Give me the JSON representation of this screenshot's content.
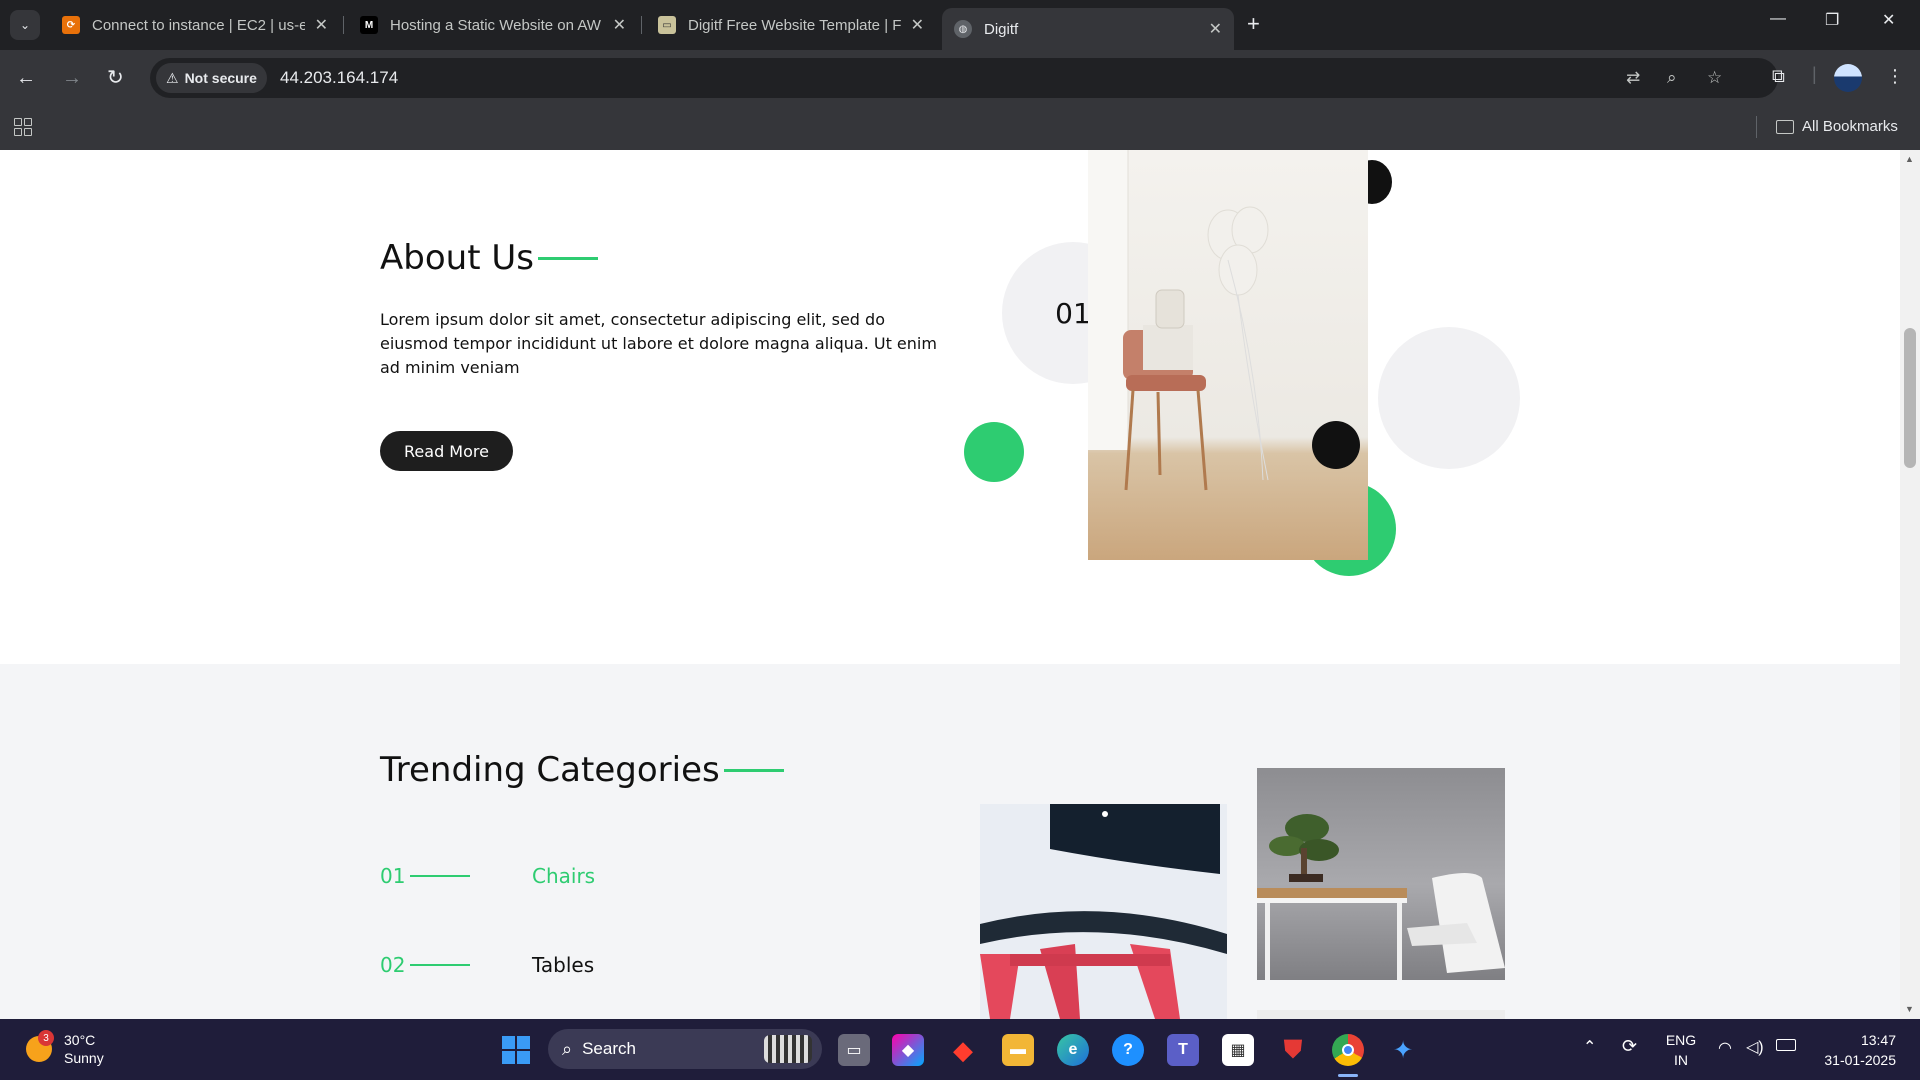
{
  "browser": {
    "tabs": [
      {
        "title": "Connect to instance | EC2 | us-e",
        "favicon": "aws-console-icon",
        "active": false
      },
      {
        "title": "Hosting a Static Website on AW",
        "favicon": "medium-icon",
        "active": false
      },
      {
        "title": "Digitf Free Website Template | F",
        "favicon": "template-site-icon",
        "active": false
      },
      {
        "title": "Digitf",
        "favicon": "globe-icon",
        "active": true
      }
    ],
    "security_label": "Not secure",
    "url": "44.203.164.174",
    "all_bookmarks_label": "All Bookmarks"
  },
  "page": {
    "about": {
      "title": "About Us",
      "text": "Lorem ipsum dolor sit amet, consectetur adipiscing elit, sed do eiusmod tempor incididunt ut labore et dolore magna aliqua. Ut enim ad minim veniam",
      "button_label": "Read More",
      "number": "01"
    },
    "trending": {
      "title": "Trending Categories",
      "categories": [
        {
          "num": "01",
          "name": "Chairs",
          "highlighted": true
        },
        {
          "num": "02",
          "name": "Tables",
          "highlighted": false
        }
      ]
    },
    "colors": {
      "accent": "#2ecc71",
      "dark": "#111111",
      "button": "#1e1e1e"
    }
  },
  "taskbar": {
    "weather": {
      "temp": "30°C",
      "condition": "Sunny",
      "badge": "3"
    },
    "search_placeholder": "Search",
    "language": {
      "line1": "ENG",
      "line2": "IN"
    },
    "time": "13:47",
    "date": "31-01-2025"
  }
}
